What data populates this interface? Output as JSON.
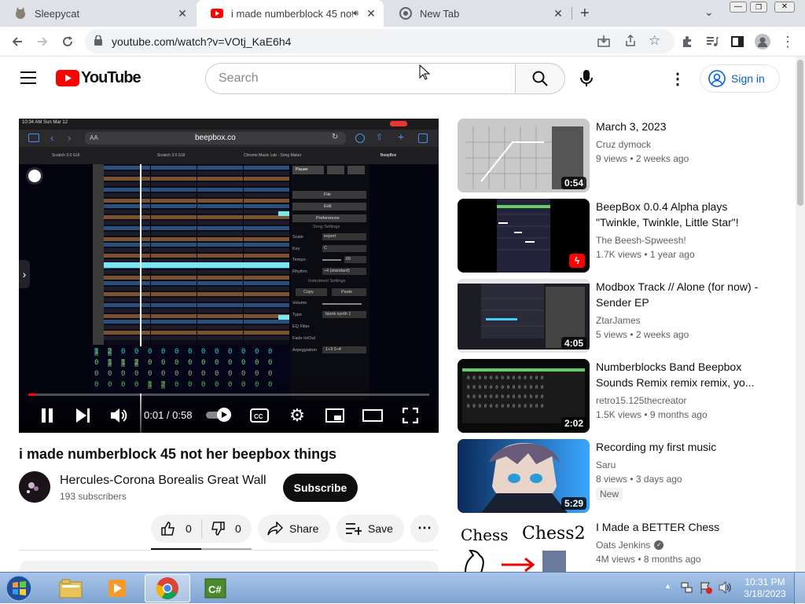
{
  "browser": {
    "tabs": [
      {
        "title": "Sleepycat",
        "active": false
      },
      {
        "title": "i made numberblock 45 not",
        "active": true
      },
      {
        "title": "New Tab",
        "active": false
      }
    ],
    "url": "youtube.com/watch?v=VOtj_KaE6h4"
  },
  "yt": {
    "logo_text": "YouTube",
    "search_placeholder": "Search",
    "signin_label": "Sign in"
  },
  "video": {
    "title": "i made numberblock 45 not her beepbox things",
    "channel": "Hercules-Corona Borealis Great Wall",
    "subscribers": "193 subscribers",
    "subscribe_label": "Subscribe",
    "likes": "0",
    "dislikes": "0",
    "share_label": "Share",
    "save_label": "Save",
    "time": "0:01 / 0:58",
    "progress": 0.02,
    "inner": {
      "status_time": "10:34 AM  Sun Mar 12",
      "site": "beepbox.co",
      "tab1": "Scratch 3.0 GUI",
      "tab2": "Scratch 3.0 GUI",
      "tab3": "Chrome Music Lab - Song Maker",
      "tab4": "BeepBox",
      "menu": [
        "Pause",
        "File",
        "Edit",
        "Preferences"
      ],
      "song_settings": "Song Settings",
      "labels": [
        "Scale",
        "Key",
        "Tempo",
        "Rhythm"
      ],
      "values": [
        "expert",
        "C",
        "69",
        "÷4 (standard)"
      ],
      "instrument_settings": "Instrument Settings",
      "copy": "Copy",
      "paste": "Paste",
      "ilabels": [
        "Volume",
        "Type",
        "EQ Filter",
        "Fade In/Out",
        "Arpeggiation"
      ],
      "ivalues": [
        "",
        "blank synth 1",
        "",
        "",
        "1÷3  2÷4"
      ]
    }
  },
  "recs": [
    {
      "title": "March 3, 2023",
      "channel": "Cruz dymock",
      "views": "9 views",
      "age": "2 weeks ago",
      "duration": "0:54"
    },
    {
      "title": "BeepBox 0.0.4 Alpha plays \"Twinkle, Twinkle, Little Star\"!",
      "channel": "The Beesh-Spweesh!",
      "views": "1.7K views",
      "age": "1 year ago",
      "duration": ""
    },
    {
      "title": "Modbox Track // Alone (for now) - Sender EP",
      "channel": "ZtarJames",
      "views": "5 views",
      "age": "2 weeks ago",
      "duration": "4:05"
    },
    {
      "title": "Numberblocks Band Beepbox Sounds Remix remix remix, yo...",
      "channel": "retro15.125thecreator",
      "views": "1.5K views",
      "age": "9 months ago",
      "duration": "2:02"
    },
    {
      "title": "Recording my first music",
      "channel": "Saru",
      "views": "8 views",
      "age": "3 days ago",
      "duration": "5:29",
      "badge": "New"
    },
    {
      "title": "I Made a BETTER Chess",
      "channel": "Oats Jenkins",
      "views": "4M views",
      "age": "8 months ago",
      "duration": "",
      "thumb_text1": "Chess",
      "thumb_text2": "Chess2"
    }
  ],
  "taskbar": {
    "time": "10:31 PM",
    "date": "3/18/2023"
  }
}
